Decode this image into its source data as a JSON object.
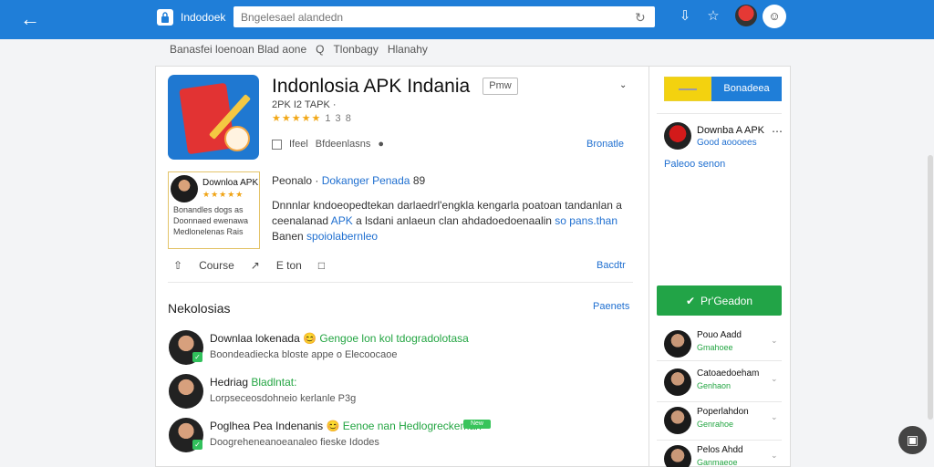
{
  "top_bar": {
    "site_label": "Indodoek",
    "search_placeholder": "Bngelesael alandedn",
    "icons": [
      "back-icon",
      "lock-icon",
      "refresh-icon",
      "download-icon",
      "bookmark-icon",
      "avatar",
      "profile-icon"
    ]
  },
  "breadcrumb": {
    "items": [
      "Banasfei loenoan Blad aone",
      "Q",
      "Tlonbagy",
      "Hlanahy"
    ]
  },
  "app": {
    "title": "Indonlosia APK Indania",
    "tag": "Pmw",
    "subline": "2PK I2 TAPK ·",
    "rating_stars": "★★★★★",
    "rating_text": "1 3 8",
    "info_label": "Ifeel",
    "info_text": "Bfdeenlasns",
    "info_link": "Bronatle"
  },
  "promo": {
    "title": "Downloa APK",
    "stars": "★★★★★",
    "text": [
      "Bonandles dogs as",
      "Doonnaed ewenawa",
      "Medlonelenas Rais"
    ]
  },
  "description": {
    "head_label": "Peonalo",
    "head_link": "Dokanger Penada",
    "head_count": "89",
    "body_1": "Dnnnlar kndoeopedtekan darlaedrl'engkla kengarla poatoan tandanlan a",
    "body_2": "ceenalanad",
    "body_3": "APK",
    "body_4": "a lsdani anlaeun clan ahdadoedoenaalin",
    "body_5": "so pans.than",
    "body_6": "Banen",
    "body_7": "spoiolabernleo"
  },
  "actions": {
    "items": [
      "Course",
      "E ton"
    ],
    "link": "Bacdtr"
  },
  "section": {
    "title": "Nekolosias",
    "link": "Paenets"
  },
  "comments": [
    {
      "title_a": "Downlaa lokenada",
      "title_b": "Gengoe lon kol tdogradolotasa",
      "text": "Boondeadiecka bloste appe o Elecoocaoe",
      "pill": ""
    },
    {
      "title_a": "Hedriag",
      "title_b": "Bladlntat:",
      "text": "Lorpseceosdohneio kerlanle P3g",
      "pill": ""
    },
    {
      "title_a": "Poglhea Pea Indenanis",
      "title_b": "Eenoe nan Hedlogreckeman",
      "text": "Doogreheneanoeanaleo fieske Idodes",
      "pill": "New"
    }
  ],
  "side": {
    "blue_btn": "Bonadeea",
    "user_name": "Downba A APK",
    "user_sub": "Good aoooees",
    "link": "Paleoo senon",
    "green_btn": "Pr'Geadon",
    "items": [
      {
        "name": "Pouo Aadd",
        "sub": "Gmahoee"
      },
      {
        "name": "Catoaedoeham",
        "sub": "Genhaon"
      },
      {
        "name": "Poperlahdon",
        "sub": "Genrahoe"
      },
      {
        "name": "Pelos Ahdd",
        "sub": "Ganmaeoe"
      }
    ]
  },
  "accent_colors": {
    "primary_blue": "#1f7ed8",
    "green": "#22a447",
    "yellow": "#f3d20f",
    "star": "#f2a818"
  }
}
